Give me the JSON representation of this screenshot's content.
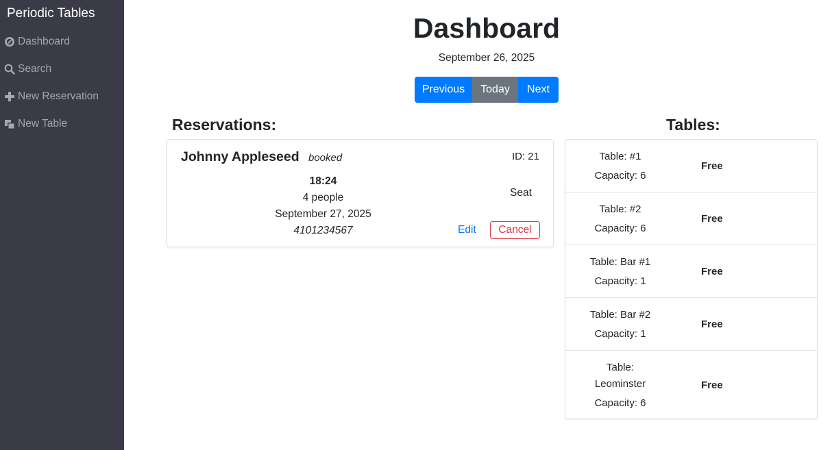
{
  "sidebar": {
    "brand": "Periodic Tables",
    "items": [
      {
        "label": "Dashboard",
        "icon": "dashboard-icon"
      },
      {
        "label": "Search",
        "icon": "search-icon"
      },
      {
        "label": "New Reservation",
        "icon": "plus-icon"
      },
      {
        "label": "New Table",
        "icon": "new-table-icon"
      }
    ]
  },
  "header": {
    "title": "Dashboard",
    "date": "September 26, 2025",
    "buttons": {
      "previous": "Previous",
      "today": "Today",
      "next": "Next"
    }
  },
  "reservations": {
    "heading": "Reservations:",
    "items": [
      {
        "name": "Johnny Appleseed",
        "status": "booked",
        "id": "ID: 21",
        "time": "18:24",
        "people": "4 people",
        "date": "September 27, 2025",
        "phone": "4101234567",
        "seat_label": "Seat",
        "edit_label": "Edit",
        "cancel_label": "Cancel"
      }
    ]
  },
  "tables": {
    "heading": "Tables:",
    "items": [
      {
        "name_line1": "Table: #1",
        "name_line2": "",
        "capacity": "Capacity: 6",
        "status": "Free"
      },
      {
        "name_line1": "Table: #2",
        "name_line2": "",
        "capacity": "Capacity: 6",
        "status": "Free"
      },
      {
        "name_line1": "Table: Bar #1",
        "name_line2": "",
        "capacity": "Capacity: 1",
        "status": "Free"
      },
      {
        "name_line1": "Table: Bar #2",
        "name_line2": "",
        "capacity": "Capacity: 1",
        "status": "Free"
      },
      {
        "name_line1": "Table:",
        "name_line2": "Leominster",
        "capacity": "Capacity: 6",
        "status": "Free"
      }
    ]
  },
  "colors": {
    "sidebar_bg": "#3a3b47",
    "primary": "#007bff",
    "secondary": "#6c757d",
    "danger": "#dc3545"
  }
}
